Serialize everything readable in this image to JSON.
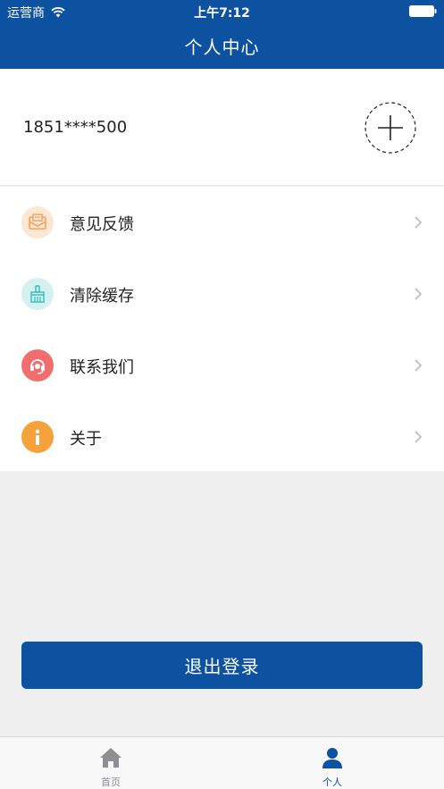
{
  "status_bar": {
    "carrier": "运营商",
    "time": "上午7:12"
  },
  "header": {
    "title": "个人中心"
  },
  "profile": {
    "phone": "1851****500",
    "avatar_icon": "plus-icon"
  },
  "menu": {
    "items": [
      {
        "label": "意见反馈",
        "icon": "mail-feedback-icon",
        "color": "#f3a15f",
        "bg": "#fde6d2"
      },
      {
        "label": "清除缓存",
        "icon": "broom-icon",
        "color": "#3cc0c0",
        "bg": "#d4f1f0"
      },
      {
        "label": "联系我们",
        "icon": "headset-icon",
        "color": "#ffffff",
        "bg": "#f06e6e"
      },
      {
        "label": "关于",
        "icon": "info-icon",
        "color": "#ffffff",
        "bg": "#f5a13c"
      }
    ]
  },
  "logout": {
    "label": "退出登录"
  },
  "tabbar": {
    "tabs": [
      {
        "label": "首页",
        "icon": "home-icon",
        "color": "#8e8e93",
        "active": false
      },
      {
        "label": "个人",
        "icon": "person-icon",
        "color": "#0d52a1",
        "active": true
      }
    ]
  },
  "colors": {
    "primary": "#0d52a1",
    "background": "#efeff0"
  }
}
